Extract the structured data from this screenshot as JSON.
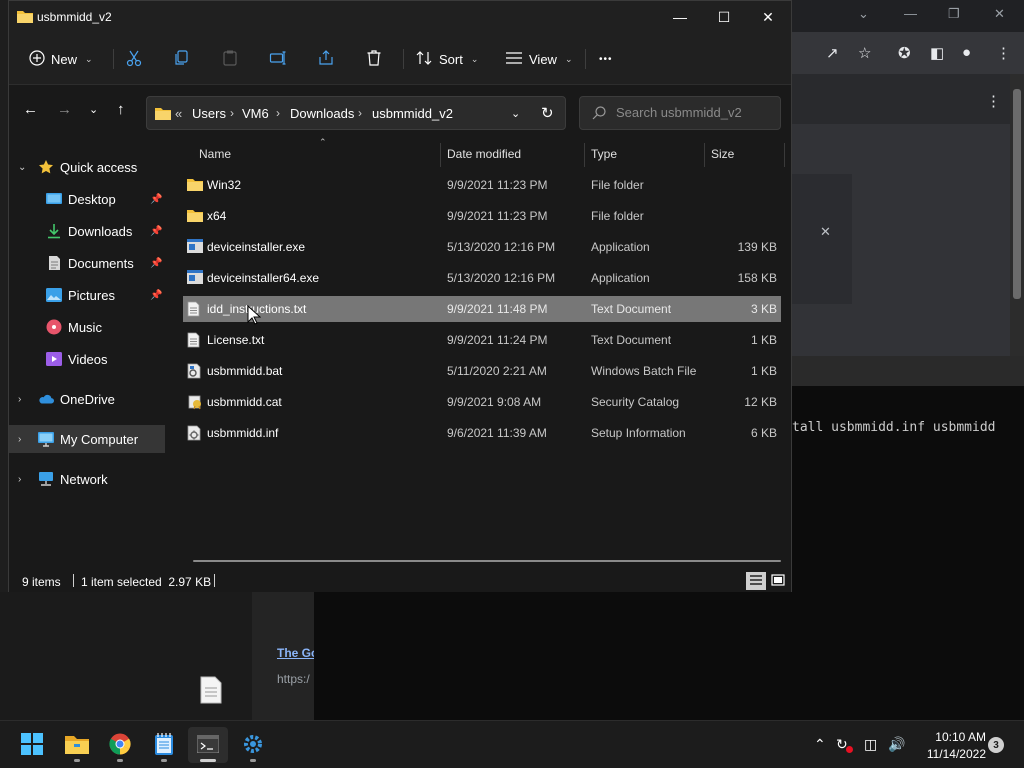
{
  "window": {
    "title": "usbmmidd_v2"
  },
  "commandbar": {
    "new_label": "New",
    "sort_label": "Sort",
    "view_label": "View",
    "more_label": "•••"
  },
  "address": {
    "overflow": "«",
    "crumbs": [
      "Users",
      "VM6",
      "Downloads",
      "usbmmidd_v2"
    ]
  },
  "search": {
    "placeholder": "Search usbmmidd_v2"
  },
  "nav": {
    "quick_access": "Quick access",
    "desktop": "Desktop",
    "downloads": "Downloads",
    "documents": "Documents",
    "pictures": "Pictures",
    "music": "Music",
    "videos": "Videos",
    "onedrive": "OneDrive",
    "my_computer": "My Computer",
    "network": "Network"
  },
  "columns": {
    "name": "Name",
    "date": "Date modified",
    "type": "Type",
    "size": "Size"
  },
  "files": [
    {
      "name": "Win32",
      "date": "9/9/2021 11:23 PM",
      "type": "File folder",
      "size": "",
      "icon": "folder-icon"
    },
    {
      "name": "x64",
      "date": "9/9/2021 11:23 PM",
      "type": "File folder",
      "size": "",
      "icon": "folder-icon"
    },
    {
      "name": "deviceinstaller.exe",
      "date": "5/13/2020 12:16 PM",
      "type": "Application",
      "size": "139 KB",
      "icon": "exe-icon"
    },
    {
      "name": "deviceinstaller64.exe",
      "date": "5/13/2020 12:16 PM",
      "type": "Application",
      "size": "158 KB",
      "icon": "exe-icon"
    },
    {
      "name": "idd_instructions.txt",
      "date": "9/9/2021 11:48 PM",
      "type": "Text Document",
      "size": "3 KB",
      "icon": "text-file-icon"
    },
    {
      "name": "License.txt",
      "date": "9/9/2021 11:24 PM",
      "type": "Text Document",
      "size": "1 KB",
      "icon": "text-file-icon"
    },
    {
      "name": "usbmmidd.bat",
      "date": "5/11/2020 2:21 AM",
      "type": "Windows Batch File",
      "size": "1 KB",
      "icon": "batch-file-icon"
    },
    {
      "name": "usbmmidd.cat",
      "date": "9/9/2021 9:08 AM",
      "type": "Security Catalog",
      "size": "12 KB",
      "icon": "catalog-icon"
    },
    {
      "name": "usbmmidd.inf",
      "date": "9/6/2021 11:39 AM",
      "type": "Setup Information",
      "size": "6 KB",
      "icon": "setup-info-icon"
    }
  ],
  "status": {
    "count": "9 items",
    "selection": "1 item selected  2.97 KB"
  },
  "background": {
    "terminal_line": "tall usbmmidd.inf usbmmidd",
    "link_text": "The Go",
    "url_text": "https:/"
  },
  "taskbar": {
    "time": "10:10 AM",
    "date": "11/14/2022",
    "notifications": "3"
  },
  "colors": {
    "accent": "#0078d4",
    "folder": "#f3c13a",
    "selection": "#777777"
  }
}
